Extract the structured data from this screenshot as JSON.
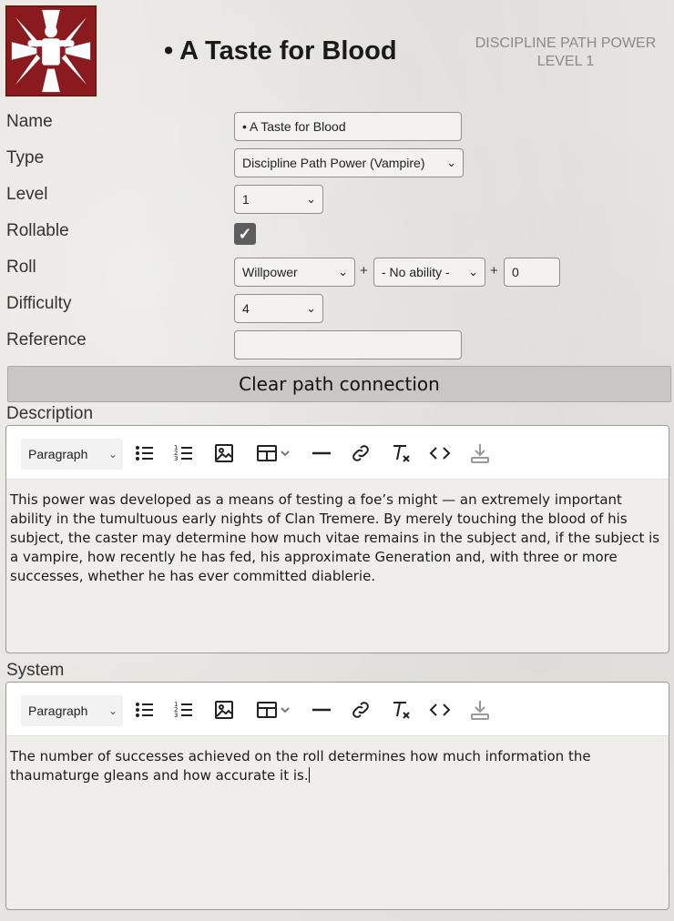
{
  "header": {
    "title": "• A Taste for Blood",
    "subtitle_line1": "DISCIPLINE PATH POWER",
    "subtitle_line2": "LEVEL 1",
    "logo_icon": "clan-figure-icon"
  },
  "form": {
    "name_label": "Name",
    "name_value": "• A Taste for Blood",
    "type_label": "Type",
    "type_value": "Discipline Path Power (Vampire)",
    "level_label": "Level",
    "level_value": "1",
    "rollable_label": "Rollable",
    "rollable_checked": true,
    "roll_label": "Roll",
    "roll_attribute": "Willpower",
    "roll_plus": "+",
    "roll_ability": "- No ability -",
    "roll_modifier": "0",
    "difficulty_label": "Difficulty",
    "difficulty_value": "4",
    "reference_label": "Reference",
    "reference_value": ""
  },
  "clear_button": "Clear path connection",
  "description": {
    "label": "Description",
    "format": "Paragraph",
    "text": "This power was developed as a means of testing a foe’s might — an extremely important ability in the tumultuous early nights of Clan Tremere. By merely touching the blood of his subject, the caster may determine how much vitae remains in the subject and, if the subject is a vampire, how recently he has fed, his approximate Generation and, with three or more successes, whether he has ever committed diablerie."
  },
  "system": {
    "label": "System",
    "format": "Paragraph",
    "text": "The number of successes achieved on the roll determines how much information the thaumaturge gleans and how accurate it is."
  },
  "colors": {
    "logo_bg": "#8b1a1f",
    "checkbox": "#5d5d5d"
  }
}
